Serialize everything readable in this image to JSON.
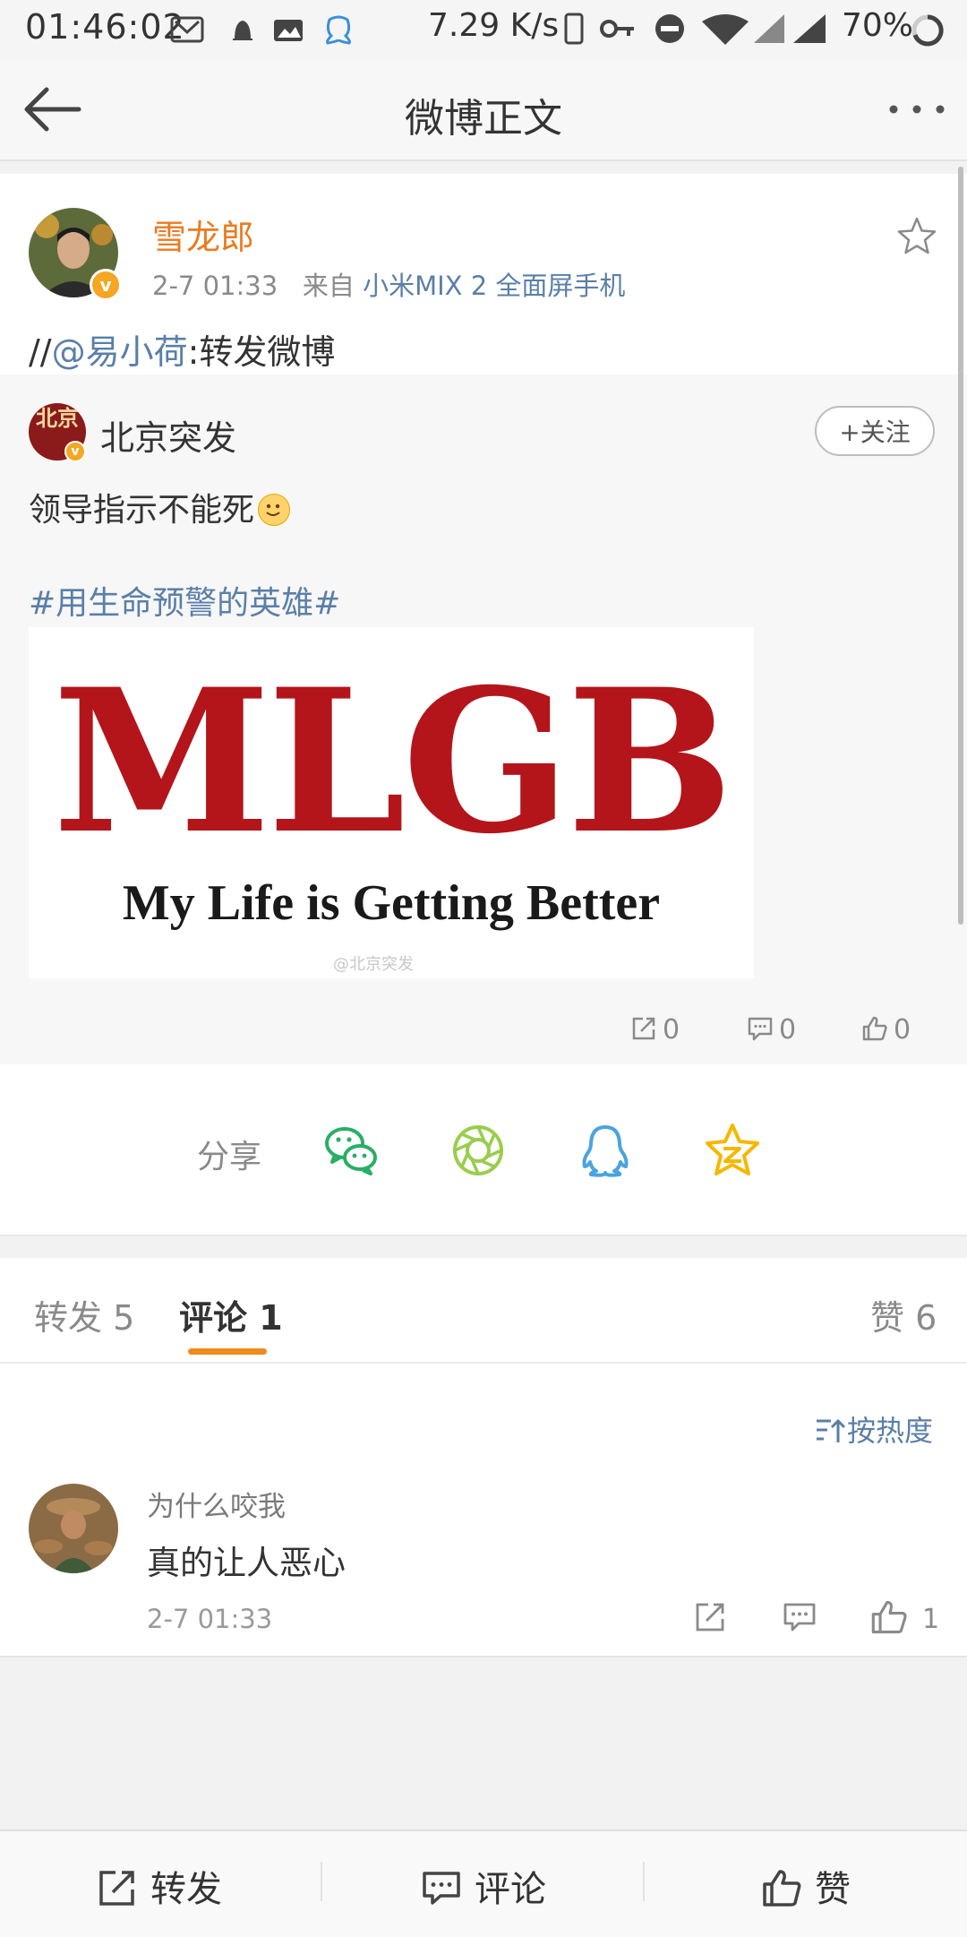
{
  "status_bar": {
    "time": "01:46:02",
    "net_speed": "7.29 K/s",
    "battery": "70%"
  },
  "header": {
    "title": "微博正文",
    "back_icon": "back-arrow-icon",
    "more_icon": "more-dots-icon"
  },
  "post": {
    "author": "雪龙郎",
    "time": "2-7 01:33",
    "source_prefix": "来自",
    "source": "小米MIX 2 全面屏手机",
    "repost_prefix": "//",
    "repost_mention": "@易小荷",
    "repost_suffix": ":转发微博",
    "verified_mark": "v",
    "favorite_icon": "star-outline-icon"
  },
  "original": {
    "author": "北京突发",
    "avatar_text": "北京",
    "follow_label": "+关注",
    "text": "领导指示不能死",
    "hashtag": "#用生命预警的英雄#",
    "image": {
      "big_text": "MLGB",
      "sub_text": "My Life is Getting Better",
      "watermark": "@北京突发"
    },
    "counts": {
      "repost": "0",
      "comment": "0",
      "like": "0"
    }
  },
  "share": {
    "label": "分享",
    "targets": [
      "wechat-icon",
      "moments-icon",
      "qq-icon",
      "qzone-icon"
    ],
    "colors": {
      "wechat": "#2aae67",
      "moments": "#9acd4c",
      "qq": "#4aa3df",
      "qzone": "#f5b800"
    }
  },
  "tabs": {
    "repost": "转发 5",
    "comment": "评论 1",
    "like": "赞 6"
  },
  "sort": {
    "label": "按热度"
  },
  "comment": {
    "user": "为什么咬我",
    "text": "真的让人恶心",
    "time": "2-7 01:33",
    "like_count": "1"
  },
  "bottom_bar": {
    "repost": "转发",
    "comment": "评论",
    "like": "赞"
  },
  "colors": {
    "accent_orange": "#eb7b20",
    "link_blue": "#5a7fa8",
    "tab_underline": "#f08a1b"
  }
}
